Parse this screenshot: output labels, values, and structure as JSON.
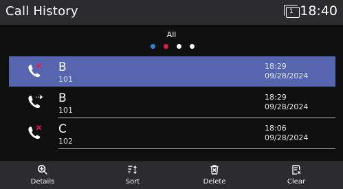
{
  "header": {
    "title": "Call History",
    "line_number": "1",
    "time": "18:40"
  },
  "filter": {
    "label": "All",
    "dot_colors": [
      "#2d84d8",
      "#e21c51",
      "#ffffff",
      "#ffffff"
    ]
  },
  "calls": [
    {
      "name": "B",
      "number": "101",
      "time": "18:29",
      "date": "09/28/2024",
      "type": "missed",
      "selected": true
    },
    {
      "name": "B",
      "number": "101",
      "time": "18:29",
      "date": "09/28/2024",
      "type": "forwarded",
      "selected": false
    },
    {
      "name": "C",
      "number": "102",
      "time": "18:06",
      "date": "09/28/2024",
      "type": "missed",
      "selected": false
    }
  ],
  "softkeys": [
    {
      "label": "Details",
      "icon": "search-plus-icon"
    },
    {
      "label": "Sort",
      "icon": "sort-icon"
    },
    {
      "label": "Delete",
      "icon": "delete-icon"
    },
    {
      "label": "Clear",
      "icon": "clear-list-icon"
    }
  ],
  "colors": {
    "selected_row": "#5565b0",
    "missed_mark": "#e21c51",
    "header_bg": "#2c2c2e"
  }
}
